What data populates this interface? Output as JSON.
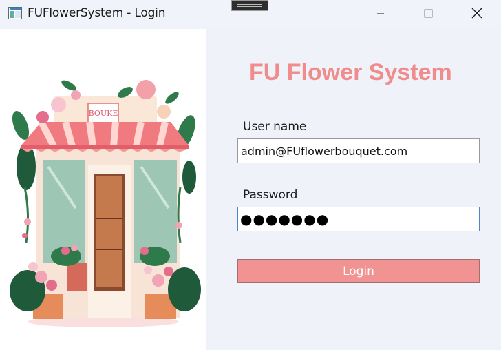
{
  "window": {
    "title": "FUFlowerSystem - Login",
    "app_icon": "window-app-icon",
    "controls": [
      "minimize-icon",
      "maximize-icon",
      "close-icon"
    ]
  },
  "illustration": {
    "description_icon": "flower-shop-illustration",
    "sign_text": "BOUKE"
  },
  "form": {
    "heading": "FU Flower System",
    "username_label": "User name",
    "username_value": "admin@FUflowerbouquet.com",
    "password_label": "Password",
    "password_masked": "●●●●●●●",
    "login_label": "Login"
  },
  "colors": {
    "accent": "#f08c8c",
    "button": "#f29393",
    "background": "#eff3f9",
    "focus_border": "#4a86c8"
  }
}
